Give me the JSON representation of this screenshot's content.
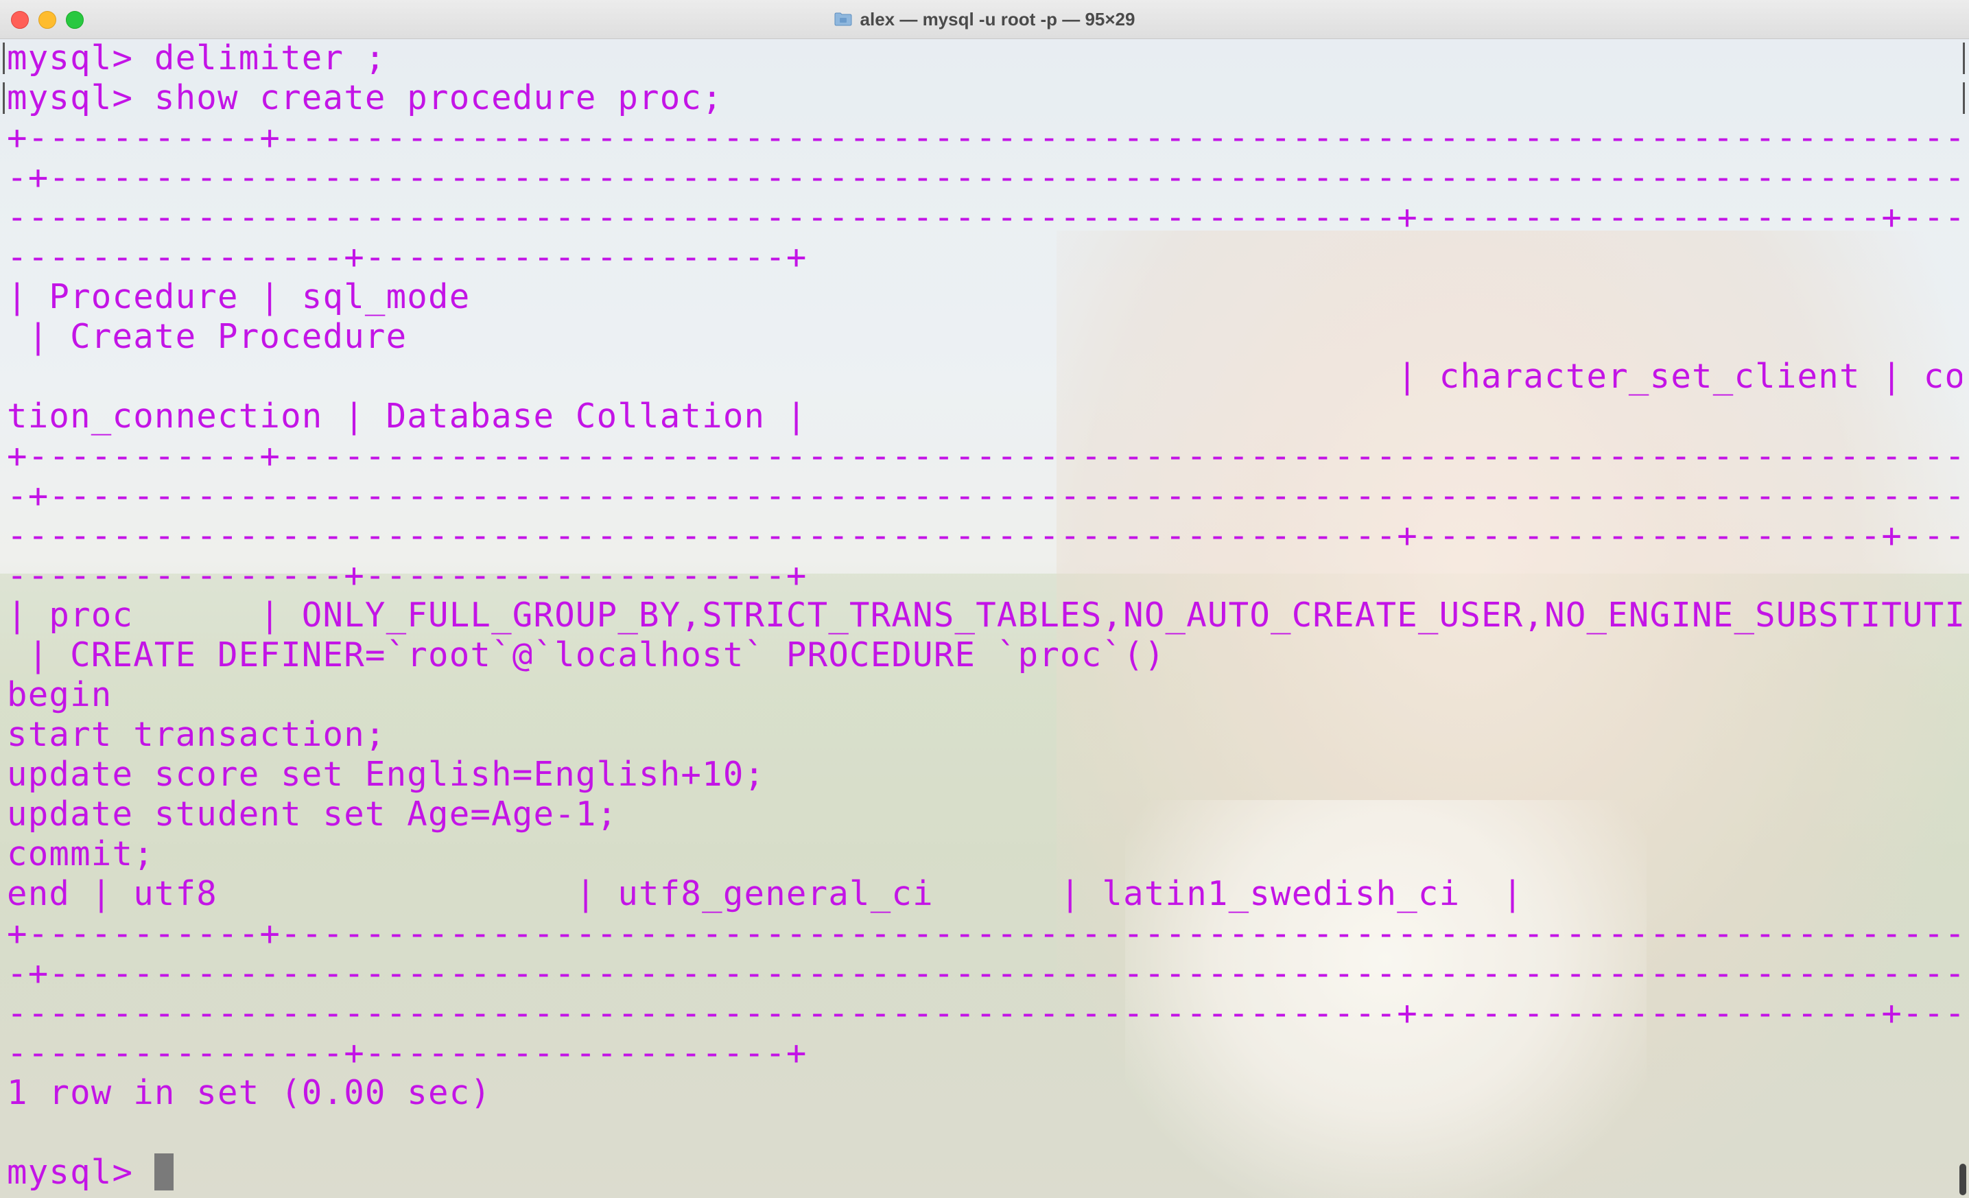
{
  "window": {
    "title": "alex — mysql -u root -p — 95×29",
    "folder_icon": "folder-icon"
  },
  "terminal": {
    "text_color": "#c314e6",
    "lines": [
      "mysql> delimiter ;",
      "mysql> show create procedure proc;",
      "+-----------+-----------------------------------------------------------------------------------------------",
      "-+----------------------------------------------------------------------------------------------",
      "------------------------------------------------------------------+----------------------+------",
      "----------------+--------------------+",
      "| Procedure | sql_mode",
      " | Create Procedure",
      "                                                                  | character_set_client | colla",
      "tion_connection | Database Collation |",
      "+-----------+-----------------------------------------------------------------------------------------------",
      "-+----------------------------------------------------------------------------------------------",
      "------------------------------------------------------------------+----------------------+------",
      "----------------+--------------------+",
      "| proc      | ONLY_FULL_GROUP_BY,STRICT_TRANS_TABLES,NO_AUTO_CREATE_USER,NO_ENGINE_SUBSTITUTION",
      " | CREATE DEFINER=`root`@`localhost` PROCEDURE `proc`()",
      "begin",
      "start transaction;",
      "update score set English=English+10;",
      "update student set Age=Age-1;",
      "commit;",
      "end | utf8                 | utf8_general_ci      | latin1_swedish_ci  |",
      "+-----------+-----------------------------------------------------------------------------------------------",
      "-+----------------------------------------------------------------------------------------------",
      "------------------------------------------------------------------+----------------------+------",
      "----------------+--------------------+",
      "1 row in set (0.00 sec)",
      "",
      "mysql> "
    ]
  }
}
